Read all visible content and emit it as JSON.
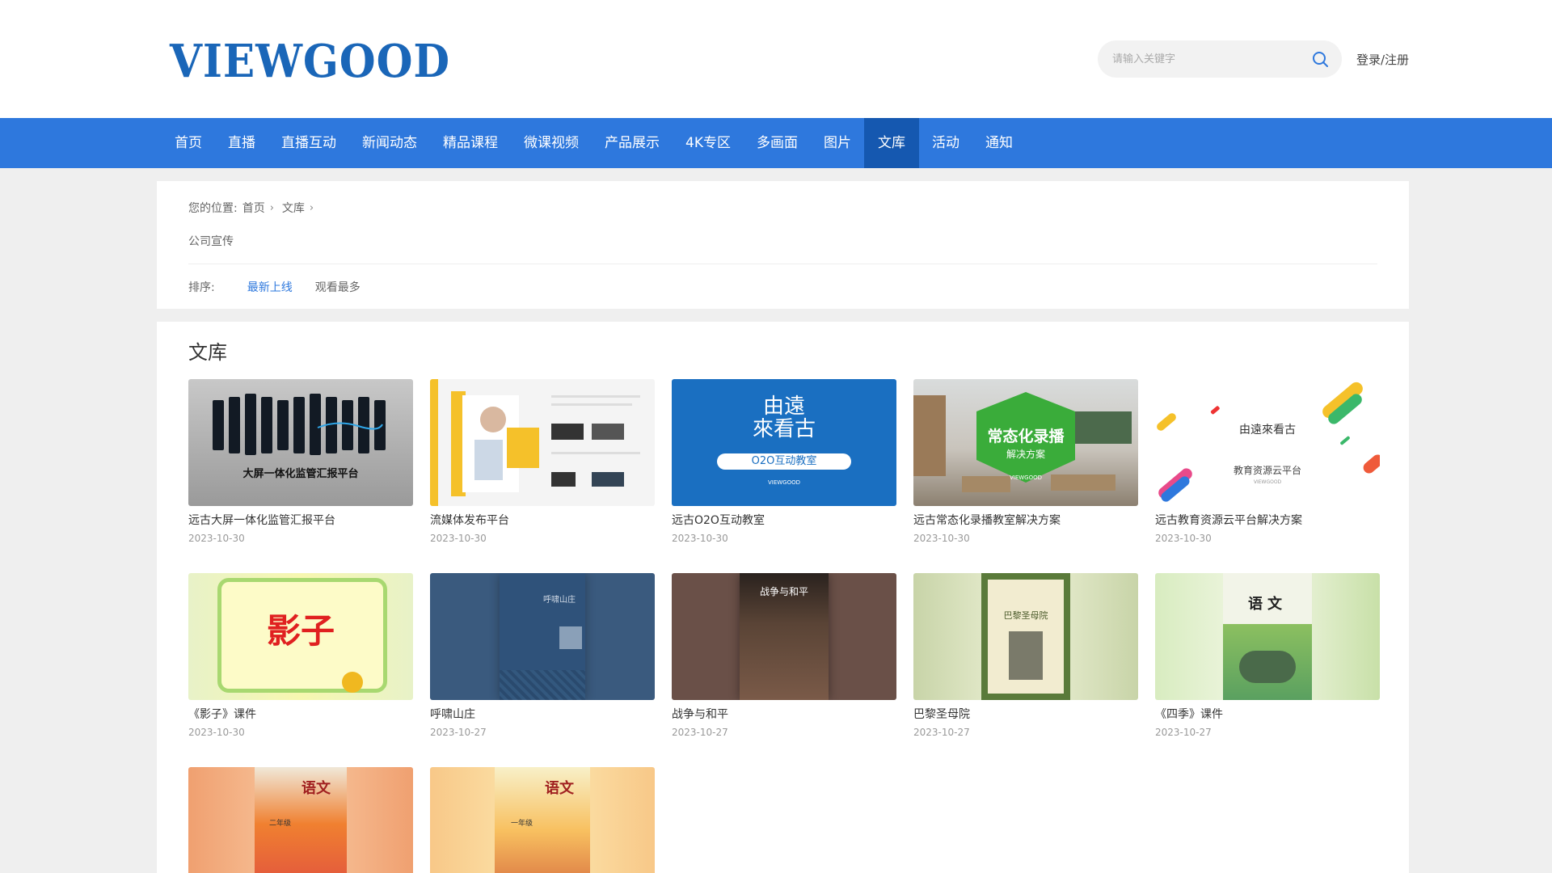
{
  "header": {
    "logo": "VIEWGOOD",
    "search_placeholder": "请输入关键字",
    "login": "登录/注册"
  },
  "nav": [
    "首页",
    "直播",
    "直播互动",
    "新闻动态",
    "精品课程",
    "微课视频",
    "产品展示",
    "4K专区",
    "多画面",
    "图片",
    "文库",
    "活动",
    "通知"
  ],
  "nav_active": "文库",
  "breadcrumb": {
    "prefix": "您的位置:",
    "home": "首页",
    "current": "文库"
  },
  "category": "公司宣传",
  "sort": {
    "label": "排序:",
    "options": [
      "最新上线",
      "观看最多"
    ],
    "active": "最新上线"
  },
  "section_title": "文库",
  "items": [
    {
      "name": "远古大屏一体化监管汇报平台",
      "date": "2023-10-30",
      "cover_title": "大屏一体化监管汇报平台"
    },
    {
      "name": "流媒体发布平台",
      "date": "2023-10-30"
    },
    {
      "name": "远古O2O互动教室",
      "date": "2023-10-30",
      "cover_label": "O2O互动教室",
      "cover_brand": "VIEWGOOD"
    },
    {
      "name": "远古常态化录播教室解决方案",
      "date": "2023-10-30",
      "cover_title": "常态化录播",
      "cover_sub": "解决方案",
      "cover_brand": "VIEWGOOD"
    },
    {
      "name": "远古教育资源云平台解决方案",
      "date": "2023-10-30",
      "cover_title": "教育资源云平台",
      "cover_brand": "VIEWGOOD"
    },
    {
      "name": "《影子》课件",
      "date": "2023-10-30",
      "cover_title": "影子"
    },
    {
      "name": "呼啸山庄",
      "date": "2023-10-27",
      "cover_title": "呼啸山庄"
    },
    {
      "name": "战争与和平",
      "date": "2023-10-27",
      "cover_title": "战争与和平"
    },
    {
      "name": "巴黎圣母院",
      "date": "2023-10-27",
      "cover_title": "巴黎圣母院"
    },
    {
      "name": "《四季》课件",
      "date": "2023-10-27",
      "cover_title": "语文"
    },
    {
      "name": "",
      "date": "",
      "cover_title": "语文",
      "cover_sub": "二年级"
    },
    {
      "name": "",
      "date": "",
      "cover_title": "语文",
      "cover_sub": "一年级"
    }
  ],
  "colors": {
    "nav": "#2e78dd",
    "nav_active": "#1558b0",
    "logo": "#1a66b8",
    "accent": "#2e78dd"
  }
}
